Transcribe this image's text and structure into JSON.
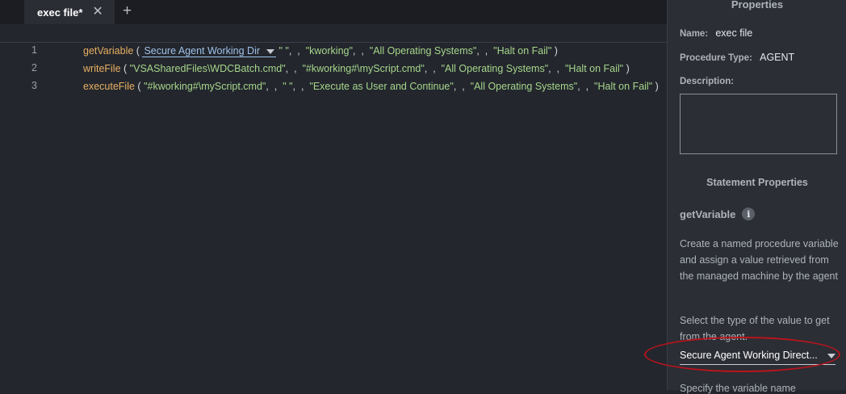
{
  "tabs": {
    "active_label": "exec file*",
    "close_glyph": "✕",
    "add_glyph": "+"
  },
  "editor": {
    "lines": [
      {
        "number": "1",
        "function": "getVariable",
        "open": " (",
        "dropdown_value": "Secure Agent Working Dir",
        "args": [
          "\"  \"",
          "\"kworking\"",
          "\"All Operating Systems\"",
          "\"Halt on Fail\""
        ],
        "close": " )"
      },
      {
        "number": "2",
        "function": "writeFile",
        "open": " (",
        "args": [
          "\"VSASharedFiles\\WDCBatch.cmd\"",
          "\"#kworking#\\myScript.cmd\"",
          "\"All Operating Systems\"",
          "\"Halt on Fail\""
        ],
        "close": " )"
      },
      {
        "number": "3",
        "function": "executeFile",
        "open": " (",
        "args": [
          "\"#kworking#\\myScript.cmd\"",
          "\"  \"",
          "\"Execute as User and Continue\"",
          "\"All Operating Systems\"",
          "\"Halt on Fail\""
        ],
        "close": " )"
      }
    ]
  },
  "panel": {
    "title": "Properties",
    "name_label": "Name:",
    "name_value": "exec file",
    "type_label": "Procedure Type:",
    "type_value": "AGENT",
    "description_label": "Description:",
    "description_value": "",
    "statement_title": "Statement Properties",
    "function_name": "getVariable",
    "info_glyph": "i",
    "help_text": "Create a named procedure variable and assign a value retrieved from the managed machine by the agent",
    "select_prompt": "Select the type of the value to get from the agent.",
    "select_value": "Secure Agent Working Direct...",
    "next_prompt": "Specify the variable name"
  },
  "colors": {
    "background": "#23262d",
    "panel": "#2b2e35",
    "function": "#e8b062",
    "string": "#a6d68b",
    "highlight_ellipse": "#b8141c"
  }
}
